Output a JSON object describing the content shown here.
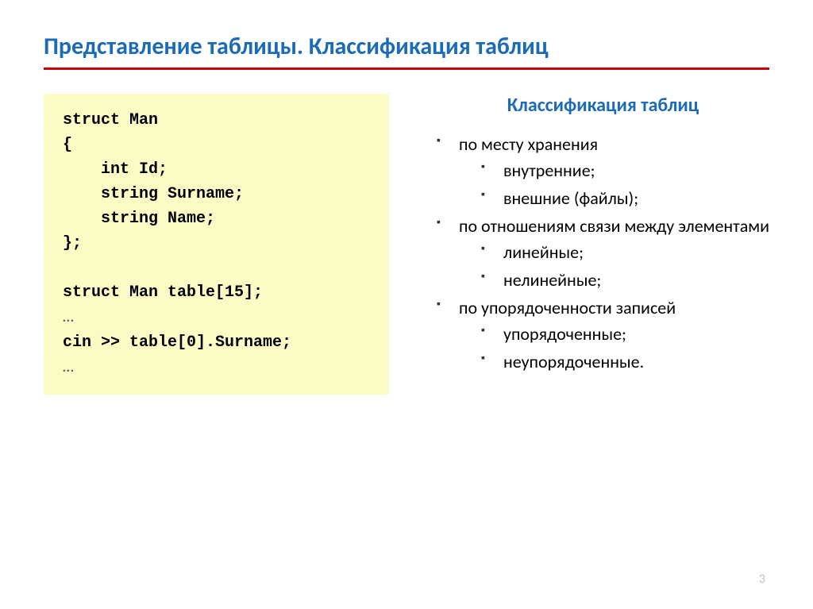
{
  "title": "Представление таблицы. Классификация таблиц",
  "code": {
    "line1": "struct Man",
    "line2": "{",
    "line3": "    int Id;",
    "line4": "    string Surname;",
    "line5": "    string Name;",
    "line6": "};",
    "line7": "",
    "line8": "struct Man table[15];",
    "line9": "…",
    "line10": "cin >> table[0].Surname;",
    "line11": "…"
  },
  "subtitle": "Классификация таблиц",
  "bullets": {
    "b1": "по месту хранения",
    "b1s1": "внутренние;",
    "b1s2": "внешние (файлы);",
    "b2": "по отношениям связи между элементами",
    "b2s1": "линейные;",
    "b2s2": "нелинейные;",
    "b3": "по упорядоченности записей",
    "b3s1": "упорядоченные;",
    "b3s2": "неупорядоченные."
  },
  "page_number": "3"
}
